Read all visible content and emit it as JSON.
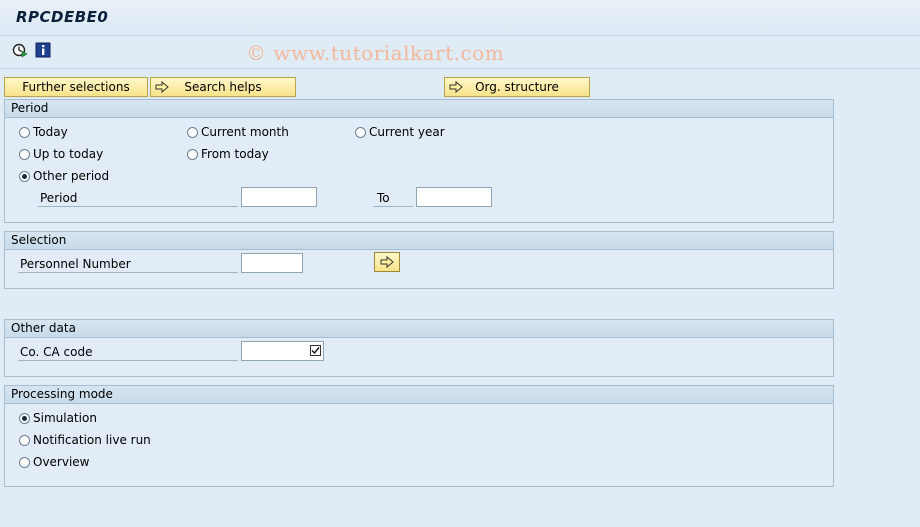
{
  "window": {
    "title": "RPCDEBE0"
  },
  "toolbar": {
    "execute_icon": "execute-icon",
    "info_icon": "info-icon"
  },
  "watermark": "© www.tutorialkart.com",
  "buttons": {
    "further_selections": "Further selections",
    "search_helps": "Search helps",
    "org_structure": "Org. structure"
  },
  "period_group": {
    "title": "Period",
    "options": {
      "today": "Today",
      "current_month": "Current month",
      "current_year": "Current year",
      "up_to_today": "Up to today",
      "from_today": "From today",
      "other_period": "Other period"
    },
    "selected": "other_period",
    "period_label": "Period",
    "to_label": "To",
    "period_from_value": "",
    "period_to_value": ""
  },
  "selection_group": {
    "title": "Selection",
    "personnel_label": "Personnel Number",
    "personnel_value": ""
  },
  "other_group": {
    "title": "Other data",
    "co_ca_label": "Co. CA code",
    "co_ca_value": "",
    "co_ca_checked": true
  },
  "processing_group": {
    "title": "Processing mode",
    "options": {
      "simulation": "Simulation",
      "notification_live_run": "Notification live run",
      "overview": "Overview"
    },
    "selected": "simulation"
  },
  "colors": {
    "background": "#dfebf5",
    "button": "#f7e38a",
    "watermark": "#f3b79b"
  }
}
